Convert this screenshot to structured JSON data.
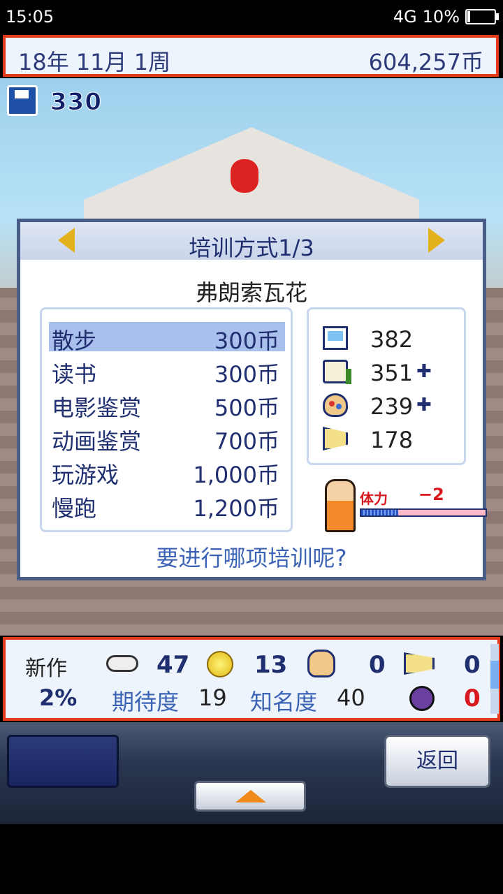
{
  "status_bar": {
    "time": "15:05",
    "network": "4G",
    "battery": "10%",
    "battery_level": 0.1
  },
  "top_banner": {
    "date": "18年 11月 1周",
    "money": "604,257币"
  },
  "save": {
    "count": "330"
  },
  "dialog": {
    "title": "培训方式1/3",
    "person": "弗朗索瓦花",
    "menu": [
      {
        "label": "散步",
        "cost": "300币",
        "selected": true
      },
      {
        "label": "读书",
        "cost": "300币"
      },
      {
        "label": "电影鉴赏",
        "cost": "500币"
      },
      {
        "label": "动画鉴赏",
        "cost": "700币"
      },
      {
        "label": "玩游戏",
        "cost": "1,000币"
      },
      {
        "label": "慢跑",
        "cost": "1,200币"
      }
    ],
    "stats": [
      {
        "icon": "monitor-icon",
        "value": "382",
        "plus": ""
      },
      {
        "icon": "book-icon",
        "value": "351",
        "plus": "✚"
      },
      {
        "icon": "palette-icon",
        "value": "239",
        "plus": "✚"
      },
      {
        "icon": "horn-icon",
        "value": "178",
        "plus": ""
      }
    ],
    "stamina_label": "体力",
    "stamina_delta": "−2",
    "stamina_level": 0.3,
    "question": "要进行哪项培训呢?"
  },
  "info_panel": {
    "new_label": "新作",
    "percent": "2%",
    "fun": "47",
    "gold": "13",
    "graphics": "0",
    "sound": "0",
    "bugs": "0",
    "expect_label": "期待度",
    "expect_value": "19",
    "fame_label": "知名度",
    "fame_value": "40"
  },
  "nav": {
    "back_label": "返回"
  }
}
